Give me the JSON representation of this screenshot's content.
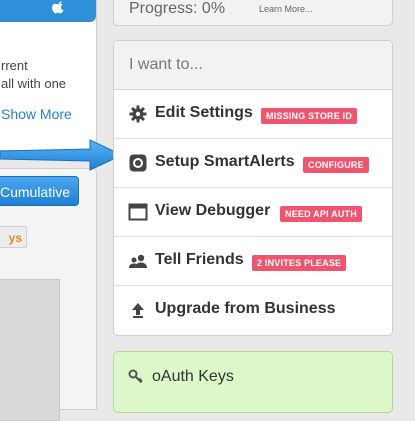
{
  "left": {
    "description": "rrent\nall with one",
    "show_more": "Show More",
    "cumulative": "Cumulative",
    "tab_label": "ys"
  },
  "progress": {
    "text": "Progress:  0%",
    "learn_more": "Learn More..."
  },
  "actions": {
    "header": "I want to...",
    "items": [
      {
        "label": "Edit Settings",
        "badge": "MISSING STORE ID",
        "icon": "gear-icon"
      },
      {
        "label": "Setup SmartAlerts",
        "badge": "CONFIGURE",
        "icon": "target-icon"
      },
      {
        "label": "View Debugger",
        "badge": "NEED API AUTH",
        "icon": "window-icon"
      },
      {
        "label": "Tell Friends",
        "badge": "2 INVITES PLEASE",
        "icon": "users-icon"
      },
      {
        "label": "Upgrade from Business",
        "badge": "",
        "icon": "upload-arrow-icon"
      }
    ]
  },
  "oauth": {
    "label": "oAuth Keys",
    "icon": "key-icon"
  },
  "colors": {
    "accent_blue": "#2f8fd9",
    "badge_red": "#f0556f",
    "oauth_green": "#dcf7c8"
  }
}
